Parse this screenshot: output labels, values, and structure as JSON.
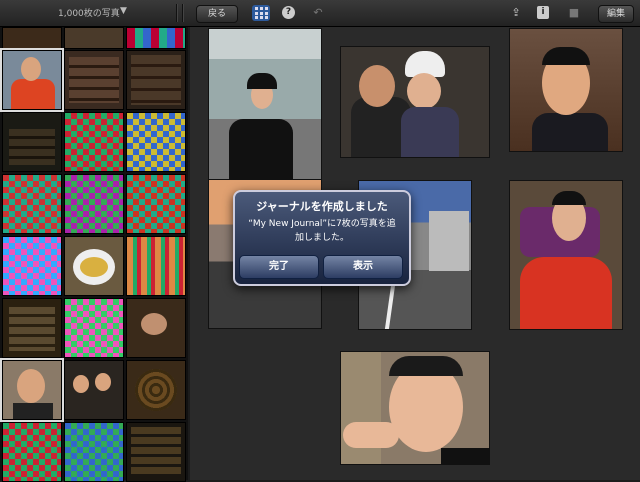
{
  "toolbar": {
    "photo_count": "1,000枚の写真",
    "dropdown_arrow": "▼",
    "back_label": "戻る",
    "edit_label": "編集",
    "icons": [
      "grid-icon",
      "help-icon",
      "undo-icon",
      "share-icon",
      "info-icon",
      "camera-icon"
    ]
  },
  "dialog": {
    "title": "ジャーナルを作成しました",
    "message": "“My New Journal”に7枚の写真を追加しました。",
    "done_label": "完了",
    "show_label": "表示"
  },
  "colors": {
    "accent": "#2d5a9c",
    "dialog_top": "#4b5a7a",
    "dialog_bottom": "#18233e"
  }
}
